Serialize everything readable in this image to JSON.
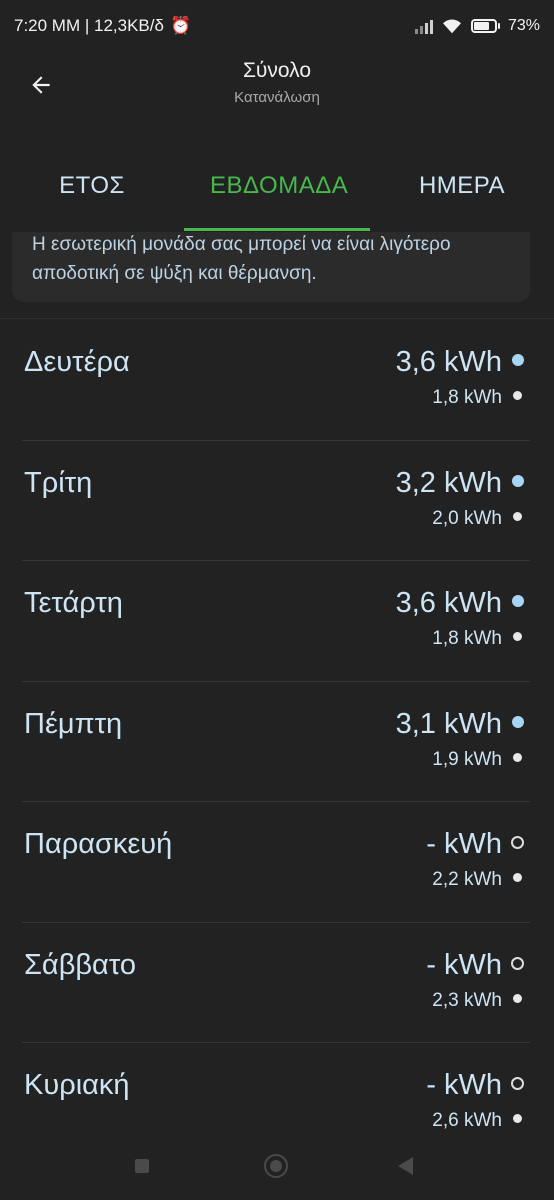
{
  "status_bar": {
    "time_info": "7:20 ΜΜ | 12,3KB/δ",
    "battery": "73%",
    "battery_level": 0.73,
    "icons": [
      "alarm-icon",
      "signal-icon",
      "wifi-icon",
      "battery-icon"
    ]
  },
  "app_bar": {
    "title": "Σύνολο",
    "subtitle": "Κατανάλωση",
    "back_icon": "arrow-left-icon"
  },
  "tabs": [
    {
      "label": "ΕΤΟΣ",
      "active": false
    },
    {
      "label": "ΕΒΔΟΜΑΔΑ",
      "active": true
    },
    {
      "label": "ΗΜΕΡΑ",
      "active": false
    }
  ],
  "info_card": {
    "text": "Η εσωτερική μονάδα σας μπορεί να είναι λιγότερο αποδοτική σε ψύξη και θέρμανση."
  },
  "days": [
    {
      "name": "Δευτέρα",
      "main": "3,6 kWh",
      "sub": "1,8 kWh",
      "main_filled": true
    },
    {
      "name": "Τρίτη",
      "main": "3,2 kWh",
      "sub": "2,0 kWh",
      "main_filled": true
    },
    {
      "name": "Τετάρτη",
      "main": "3,6 kWh",
      "sub": "1,8 kWh",
      "main_filled": true
    },
    {
      "name": "Πέμπτη",
      "main": "3,1 kWh",
      "sub": "1,9 kWh",
      "main_filled": true
    },
    {
      "name": "Παρασκευή",
      "main": "- kWh",
      "sub": "2,2 kWh",
      "main_filled": false
    },
    {
      "name": "Σάββατο",
      "main": "- kWh",
      "sub": "2,3 kWh",
      "main_filled": false
    },
    {
      "name": "Κυριακή",
      "main": "- kWh",
      "sub": "2,6 kWh",
      "main_filled": false
    }
  ],
  "colors": {
    "background": "#222222",
    "accent": "#47b84e",
    "text_blue": "#cde4f4",
    "dot_blue": "#a8d4f5"
  }
}
